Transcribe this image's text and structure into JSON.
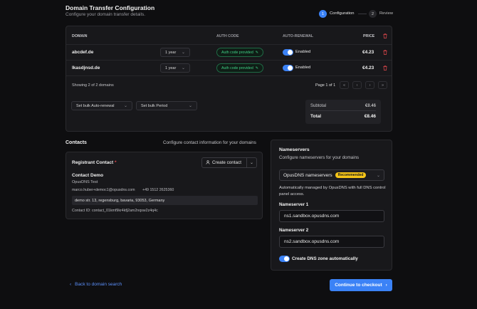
{
  "header": {
    "title": "Domain Transfer Configuration",
    "subtitle": "Configure your domain transfer details."
  },
  "steps": [
    {
      "number": "1",
      "label": "Configuration"
    },
    {
      "number": "2",
      "label": "Review"
    }
  ],
  "table": {
    "headers": {
      "domain": "DOMAIN",
      "auth_code": "AUTH CODE",
      "auto_renewal": "AUTO-RENEWAL",
      "price": "PRICE"
    },
    "rows": [
      {
        "domain": "abcdef.de",
        "period": "1 year",
        "auth": "Auth code provided",
        "renewal": "Enabled",
        "price": "€4.23"
      },
      {
        "domain": "lkasdjnsd.de",
        "period": "1 year",
        "auth": "Auth code provided",
        "renewal": "Enabled",
        "price": "€4.23"
      }
    ],
    "showing": "Showing 2 of 2 domains",
    "page": "Page 1 of 1",
    "bulk_auto_renewal": "Set bulk Auto-renewal",
    "bulk_period": "Set bulk Period",
    "subtotal_label": "Subtotal",
    "subtotal_value": "€8.46",
    "total_label": "Total",
    "total_value": "€8.46"
  },
  "contacts": {
    "title": "Contacts",
    "description": "Configure contact information for your domains",
    "registrant_label": "Registrant Contact",
    "required_mark": "*",
    "create_contact": "Create contact",
    "name": "Contact Demo",
    "company": "OpusDNS Test",
    "email": "marco.huber+democ1@opusdns.com",
    "phone": "+49 1512 2625360",
    "address": "demo str. 13, regensburg, bavaria, 93053, Germany",
    "contact_id": "Contact ID: contact_01kmf9kr4kfj2am2nqsw2z4q4c"
  },
  "nameservers": {
    "title": "Nameservers",
    "description": "Configure nameservers for your domains",
    "select_label": "OpusDNS nameservers",
    "recommended": "Recommended",
    "info": "Automatically managed by OpusDNS with full DNS control panel access.",
    "ns1_label": "Nameserver 1",
    "ns1_value": "ns1.sandbox.opusdns.com",
    "ns2_label": "Nameserver 2",
    "ns2_value": "ns2.sandbox.opusdns.com",
    "dns_zone_label": "Create DNS zone automatically"
  },
  "footer": {
    "back": "Back to domain search",
    "continue": "Continue to checkout"
  }
}
